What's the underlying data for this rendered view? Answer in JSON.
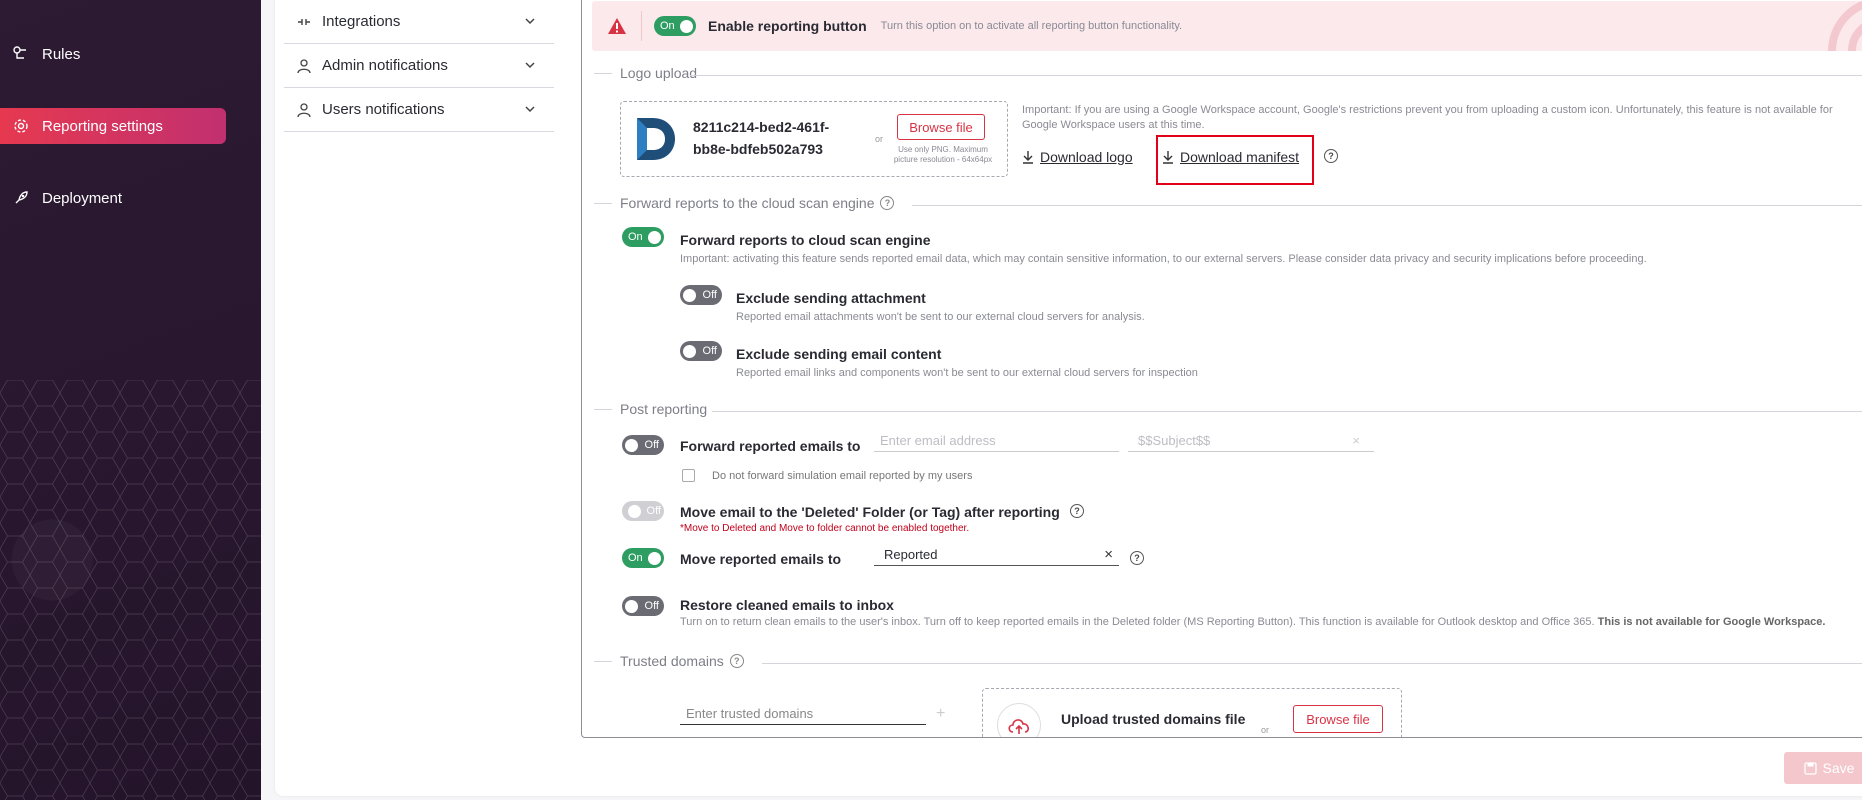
{
  "leftnav": {
    "items": [
      {
        "label": "Rules",
        "icon": "rules-icon"
      },
      {
        "label": "Reporting settings",
        "icon": "gear-icon"
      },
      {
        "label": "Deployment",
        "icon": "rocket-icon"
      }
    ]
  },
  "subnav": {
    "items": [
      {
        "label": "Integrations"
      },
      {
        "label": "Admin notifications"
      },
      {
        "label": "Users notifications"
      }
    ]
  },
  "banner": {
    "toggle": "On",
    "title": "Enable reporting button",
    "desc": "Turn this option on to activate all reporting button functionality."
  },
  "logo": {
    "section": "Logo upload",
    "guid": "8211c214-bed2-461f-bb8e-bdfeb502a793",
    "or": "or",
    "browse": "Browse file",
    "hint": "Use only PNG. Maximum picture resolution - 64x64px",
    "note": "Important: If you are using a Google Workspace account, Google's restrictions prevent you from uploading a custom icon. Unfortunately, this feature is not available for Google Workspace users at this time.",
    "download_logo": "Download logo",
    "download_manifest": "Download manifest"
  },
  "forward": {
    "section": "Forward reports to the cloud scan engine",
    "main_toggle": "On",
    "main_title": "Forward reports to cloud scan engine",
    "main_desc": "Important: activating this feature sends reported email data, which may contain sensitive information, to our external servers. Please consider data privacy and security implications before proceeding.",
    "attach_toggle": "Off",
    "attach_title": "Exclude sending attachment",
    "attach_desc": "Reported email attachments won't be sent to our external cloud servers for analysis.",
    "content_toggle": "Off",
    "content_title": "Exclude sending email content",
    "content_desc": "Reported email links and components won't be sent to our external cloud servers for inspection"
  },
  "post": {
    "section": "Post reporting",
    "fwd_toggle": "Off",
    "fwd_title": "Forward reported emails to",
    "fwd_email_placeholder": "Enter email address",
    "fwd_subject_placeholder": "$$Subject$$",
    "fwd_checkbox": "Do not forward simulation email reported by my users",
    "deleted_toggle": "Off",
    "deleted_title": "Move email to the 'Deleted' Folder (or Tag) after reporting",
    "err_a": "*Move to Deleted",
    "err_and": " and ",
    "err_b": "Move to folder",
    "err_c": " cannot be enabled together.",
    "move_toggle": "On",
    "move_title": "Move reported emails to",
    "move_value": "Reported",
    "restore_toggle": "Off",
    "restore_title": "Restore cleaned emails to inbox",
    "restore_desc": "Turn on to return clean emails to the user's inbox. Turn off to keep reported emails in the Deleted folder (MS Reporting Button). This function is available for Outlook desktop and Office 365.",
    "restore_desc_bold": " This is not available for Google Workspace."
  },
  "trusted": {
    "section": "Trusted domains",
    "input_placeholder": "Enter trusted domains",
    "plus": "+",
    "upload_title": "Upload trusted domains file",
    "or": "or",
    "browse": "Browse file"
  },
  "save": "Save",
  "colors": {
    "accent": "#d73345",
    "on": "#2e9d62",
    "off": "#6b6b74",
    "nav_bg": "#2a1830"
  }
}
